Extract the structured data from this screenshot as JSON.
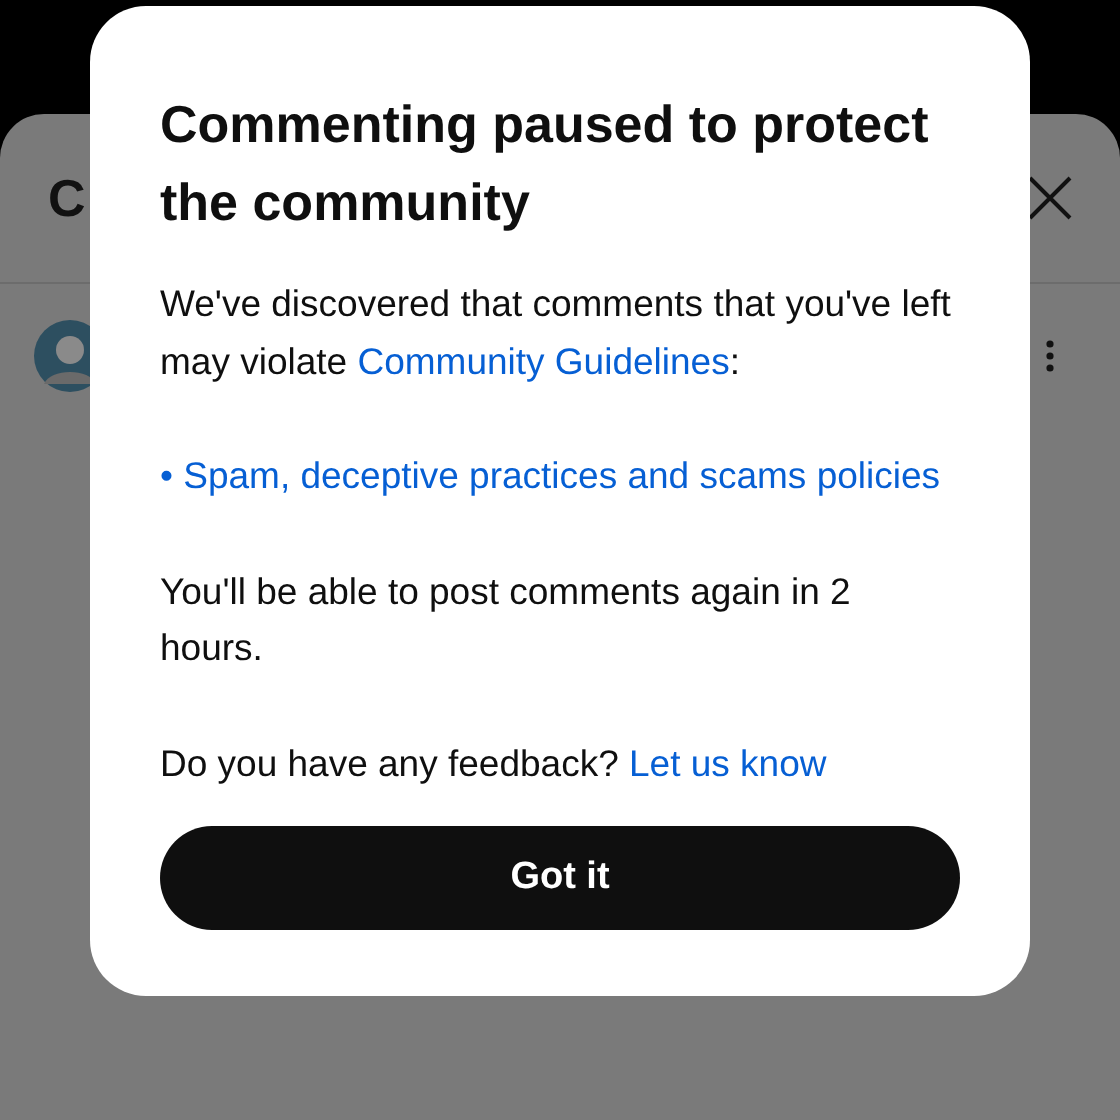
{
  "background": {
    "title": "C"
  },
  "dialog": {
    "title": "Commenting paused to protect the community",
    "body": [
      {
        "kind": "text_with_link",
        "text": "We've discovered that comments that you've left may violate ",
        "link": "Community Guidelines",
        "after": ":"
      },
      {
        "kind": "link",
        "text": "• Spam, deceptive practices and scams policies"
      },
      {
        "kind": "text",
        "text": "You'll be able to post comments again in 2 hours."
      },
      {
        "kind": "text_with_link",
        "text": "Do you have any feedback? ",
        "link": "Let us know"
      }
    ],
    "button": "Got it"
  }
}
